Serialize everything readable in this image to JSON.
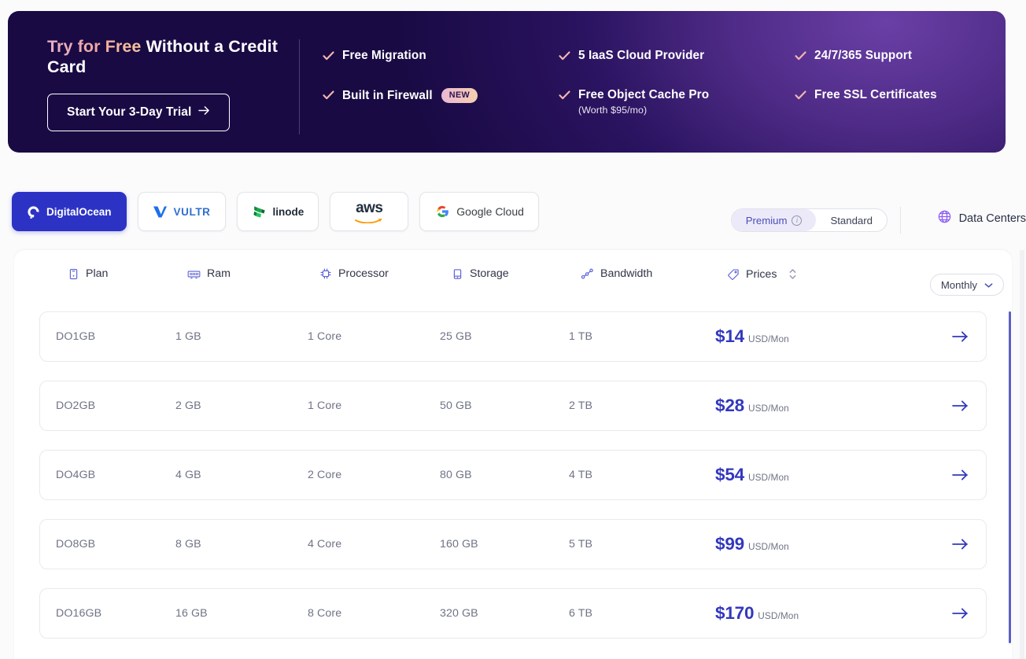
{
  "banner": {
    "title_highlight": "Try for Free",
    "title_rest": " Without a Credit Card",
    "cta_label": "Start Your 3-Day Trial",
    "cta_arrow": "→",
    "features": [
      {
        "label": "Free Migration",
        "sub": "",
        "badge": ""
      },
      {
        "label": "5 IaaS Cloud Provider",
        "sub": "",
        "badge": ""
      },
      {
        "label": "24/7/365 Support",
        "sub": "",
        "badge": ""
      },
      {
        "label": "Built in Firewall",
        "sub": "",
        "badge": "NEW"
      },
      {
        "label": "Free Object Cache Pro",
        "sub": "(Worth $95/mo)",
        "badge": ""
      },
      {
        "label": "Free SSL Certificates",
        "sub": "",
        "badge": ""
      }
    ],
    "check_icon": "check-icon",
    "colors": {
      "bg_dark": "#170a42",
      "bg_purple": "#6a3fa6",
      "check": "#f3b6b0",
      "badge_from": "#eab8d4",
      "badge_to": "#f5cfae"
    }
  },
  "providers": [
    {
      "name": "DigitalOcean",
      "label": "DigitalOcean",
      "icon": "digitalocean-logo",
      "active": true
    },
    {
      "name": "Vultr",
      "label": "VULTR",
      "icon": "vultr-logo",
      "active": false
    },
    {
      "name": "Linode",
      "label": "linode",
      "icon": "linode-logo",
      "active": false
    },
    {
      "name": "AWS",
      "label": "aws",
      "icon": "aws-logo",
      "active": false
    },
    {
      "name": "GoogleCloud",
      "label": "Google Cloud",
      "icon": "google-cloud-logo",
      "active": false
    }
  ],
  "tier_toggle": {
    "premium_label": "Premium",
    "standard_label": "Standard",
    "selected": "Premium",
    "info_icon": "info-icon"
  },
  "data_centers": {
    "label": "Data Centers",
    "icon": "globe-icon"
  },
  "table": {
    "columns": [
      {
        "key": "plan",
        "label": "Plan",
        "icon": "server-icon"
      },
      {
        "key": "ram",
        "label": "Ram",
        "icon": "memory-icon"
      },
      {
        "key": "processor",
        "label": "Processor",
        "icon": "cpu-icon"
      },
      {
        "key": "storage",
        "label": "Storage",
        "icon": "harddrive-icon"
      },
      {
        "key": "bandwidth",
        "label": "Bandwidth",
        "icon": "network-icon"
      },
      {
        "key": "prices",
        "label": "Prices",
        "icon": "tag-icon",
        "sortable": true,
        "sort_icon": "sort-updown-icon"
      }
    ],
    "billing_dropdown": {
      "value": "Monthly",
      "icon": "chevron-down-icon"
    },
    "row_arrow_icon": "arrow-right-icon",
    "price_unit": "USD/Mon",
    "rows": [
      {
        "plan": "DO1GB",
        "ram": "1 GB",
        "processor": "1 Core",
        "storage": "25 GB",
        "bandwidth": "1 TB",
        "price": "$14",
        "unit": "USD/Mon"
      },
      {
        "plan": "DO2GB",
        "ram": "2 GB",
        "processor": "1 Core",
        "storage": "50 GB",
        "bandwidth": "2 TB",
        "price": "$28",
        "unit": "USD/Mon"
      },
      {
        "plan": "DO4GB",
        "ram": "4 GB",
        "processor": "2 Core",
        "storage": "80 GB",
        "bandwidth": "4 TB",
        "price": "$54",
        "unit": "USD/Mon"
      },
      {
        "plan": "DO8GB",
        "ram": "8 GB",
        "processor": "4 Core",
        "storage": "160 GB",
        "bandwidth": "5 TB",
        "price": "$99",
        "unit": "USD/Mon"
      },
      {
        "plan": "DO16GB",
        "ram": "16 GB",
        "processor": "8 Core",
        "storage": "320 GB",
        "bandwidth": "6 TB",
        "price": "$170",
        "unit": "USD/Mon"
      }
    ]
  },
  "colors": {
    "accent_blue": "#2c33c4",
    "price_blue": "#3238bd",
    "icon_purple": "#5b5fd6",
    "text_gray": "#6f7385",
    "page_bg": "#fbfbfc"
  }
}
